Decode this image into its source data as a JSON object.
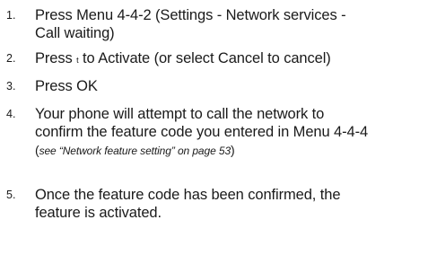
{
  "steps": [
    {
      "number": "1.",
      "lines": [
        "Press Menu 4-4-2 (Settings - Network services -",
        "Call waiting)"
      ]
    },
    {
      "number": "2.",
      "before_key": "Press ",
      "key": "t",
      "after_key": " to Activate (or select Cancel to cancel)"
    },
    {
      "number": "3.",
      "text": "Press OK"
    },
    {
      "number": "4.",
      "lines": [
        "Your phone will attempt to call the network to",
        "confirm the feature code you entered in Menu 4-4-4"
      ],
      "ref_open": "(",
      "ref_text": "see “Network feature setting” on page 53",
      "ref_close": ")"
    },
    {
      "number": "5.",
      "lines": [
        "Once the feature code has been confirmed, the",
        "feature is activated."
      ]
    }
  ]
}
